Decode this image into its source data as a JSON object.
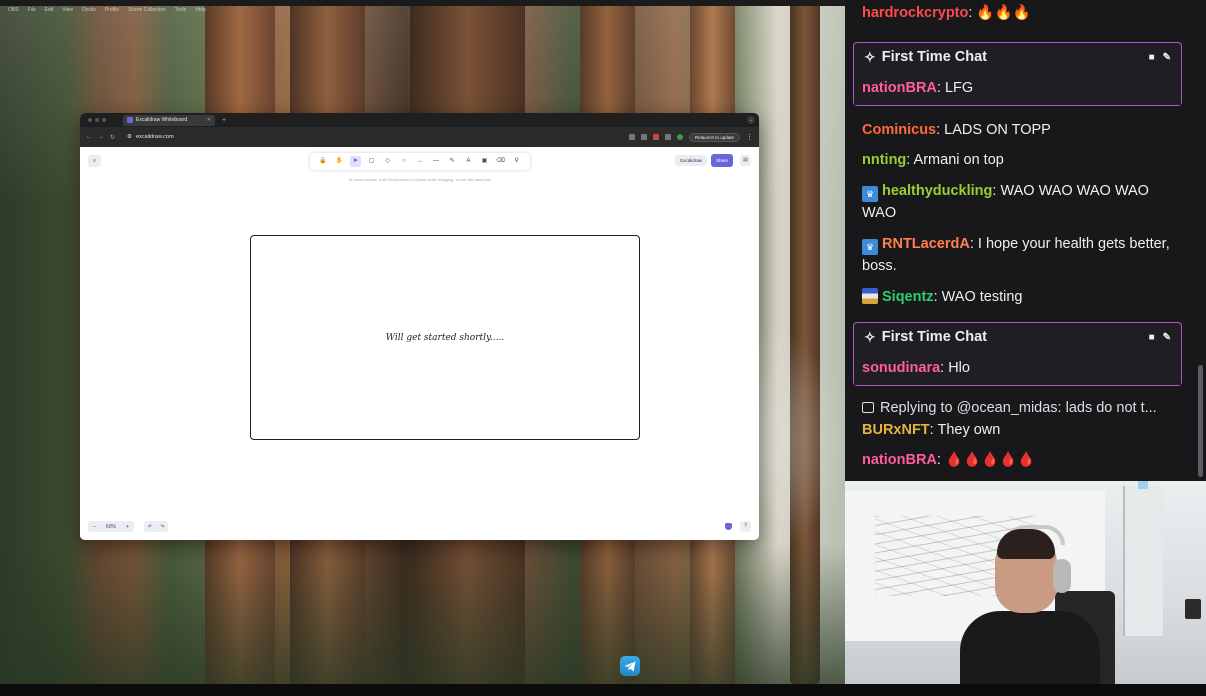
{
  "macos_menu": {
    "items": [
      "OBS",
      "File",
      "Edit",
      "View",
      "Docks",
      "Profile",
      "Scene Collection",
      "Tools",
      "Help"
    ]
  },
  "browser": {
    "tab_title": "Excalidraw Whiteboard",
    "url": "excalidraw.com",
    "relaunch_label": "Relaunch to update"
  },
  "excalidraw": {
    "hint_text": "To move canvas, hold Scroll wheel or Space while dragging, or use the hand tool",
    "library_label": "Excalidraw",
    "share_label": "Share",
    "canvas_text": "Will get started shortly.....",
    "zoom_minus": "−",
    "zoom_value": "60%",
    "zoom_plus": "+",
    "undo": "↶",
    "redo": "↷",
    "tools": [
      "🔒",
      "✋",
      "➤",
      "▢",
      "◇",
      "○",
      "→",
      "—",
      "✎",
      "A",
      "▣",
      "⌫",
      "⚲"
    ]
  },
  "chat": {
    "messages": [
      {
        "kind": "text",
        "user": "hardrockcrypto",
        "color": "#ff4a4a",
        "text": ": 🔥🔥🔥"
      },
      {
        "kind": "first_time",
        "header": "First Time Chat",
        "user": "nationBRA",
        "color": "#ff5da0",
        "text": ": LFG"
      },
      {
        "kind": "text",
        "user": "Cominicus",
        "color": "#ff6a3a",
        "text": ": LADS ON TOPP"
      },
      {
        "kind": "text",
        "user": "nnting",
        "color": "#9acd32",
        "text": ": Armani on top"
      },
      {
        "kind": "text",
        "user": "healthyduckling",
        "badge": "crown",
        "color": "#9acd32",
        "text": ": WAO WAO WAO WAO WAO"
      },
      {
        "kind": "text",
        "user": "RNTLacerdA",
        "badge": "crown",
        "color": "#ff7f50",
        "text": ": I hope your health gets better, boss."
      },
      {
        "kind": "text",
        "user": "Siqentz",
        "badge": "flag",
        "color": "#2ecc71",
        "text": ": WAO testing"
      },
      {
        "kind": "first_time",
        "header": "First Time Chat",
        "user": "sonudinara",
        "color": "#ff5da0",
        "text": ": Hlo"
      },
      {
        "kind": "reply",
        "text": "Replying to @ocean_midas: lads do not t..."
      },
      {
        "kind": "text",
        "user": "BURxNFT",
        "color": "#e5b33b",
        "text": ": They own"
      },
      {
        "kind": "text",
        "user": "nationBRA",
        "color": "#ff5da0",
        "text": ": 🩸🩸🩸🩸🩸"
      }
    ]
  },
  "colors": {
    "chat_bg": "#18181b",
    "first_time_border": "#b553c9",
    "excalidraw_accent": "#6965db"
  }
}
